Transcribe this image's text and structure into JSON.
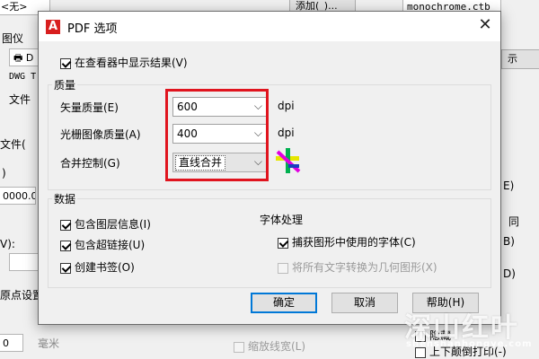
{
  "background_window": {
    "field_none": "<无>",
    "btn_add": "添加(_)...",
    "plotstyle_file": "monochrome.ctb",
    "label_plotter": "图仪",
    "plotter_value": "D",
    "label_dwg": "DWG T",
    "label_file": "文件",
    "label_file2": "文件(",
    "label_paren": ")",
    "field_number": "0000.00",
    "label_paren_v": "V):",
    "right_btn_show": "示",
    "right_small_a": "E)",
    "right_small_b": "同",
    "right_small_c": "B)",
    "right_small_d": "D)",
    "label_origin": "原点设置",
    "field_zero": "0",
    "label_mm": "毫米",
    "label_scale_lineweight": "缩放线宽(L)",
    "label_updown": "上下颠倒打印(-)",
    "label_hide": "隐藏"
  },
  "dialog": {
    "title": "PDF 选项",
    "app_icon_letter": "A",
    "close_label": "✕",
    "show_results_label": "在查看器中显示结果(V)",
    "quality_group": "质量",
    "vector_quality_label": "矢量质量(E)",
    "vector_quality_value": "600",
    "raster_quality_label": "光栅图像质量(A)",
    "raster_quality_value": "400",
    "merge_control_label": "合并控制(G)",
    "merge_control_value": "直线合并",
    "dpi_unit_1": "dpi",
    "dpi_unit_2": "dpi",
    "data_group": "数据",
    "include_layers_label": "包含图层信息(I)",
    "include_hyperlinks_label": "包含超链接(U)",
    "create_bookmarks_label": "创建书签(O)",
    "font_handling_heading": "字体处理",
    "capture_fonts_label": "捕获图形中使用的字体(C)",
    "convert_text_label": "将所有文字转换为几何图形(X)",
    "ok_label": "确定",
    "cancel_label": "取消",
    "help_label": "帮助(H)"
  },
  "state": {
    "show_results_checked": true,
    "include_layers_checked": true,
    "include_hyperlinks_checked": true,
    "create_bookmarks_checked": true,
    "capture_fonts_checked": true,
    "convert_text_checked": false,
    "convert_text_disabled": true
  },
  "colors": {
    "highlight_border": "#e0141e",
    "app_icon": "#d81e1e",
    "primary_button_border": "#0078d7"
  },
  "watermark": {
    "main": "深山红叶",
    "sub": "shenshanhongye.com"
  }
}
